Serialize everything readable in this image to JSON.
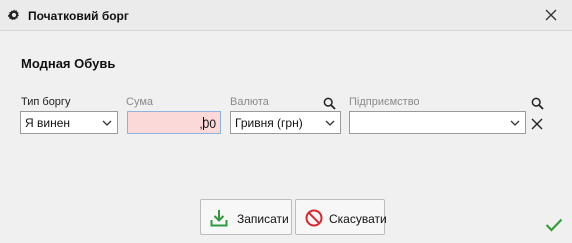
{
  "window": {
    "title": "Початковий борг"
  },
  "company_name": "Модная Обувь",
  "form": {
    "debt_type": {
      "label": "Тип боргу",
      "value": "Я винен"
    },
    "amount": {
      "label": "Сума",
      "value": ",00"
    },
    "currency": {
      "label": "Валюта",
      "value": "Гривня (грн)"
    },
    "enterprise": {
      "label": "Підприємство",
      "value": ""
    }
  },
  "buttons": {
    "save": "Записати",
    "cancel": "Скасувати"
  },
  "colors": {
    "accent_green": "#3a9d3a",
    "cancel_red": "#d9272e",
    "amount_bg": "#fcd9d9"
  },
  "icons": [
    "gear-icon",
    "close-icon",
    "chevron-down-icon",
    "search-icon",
    "clear-icon",
    "download-icon",
    "cancel-icon",
    "checkmark-icon"
  ]
}
